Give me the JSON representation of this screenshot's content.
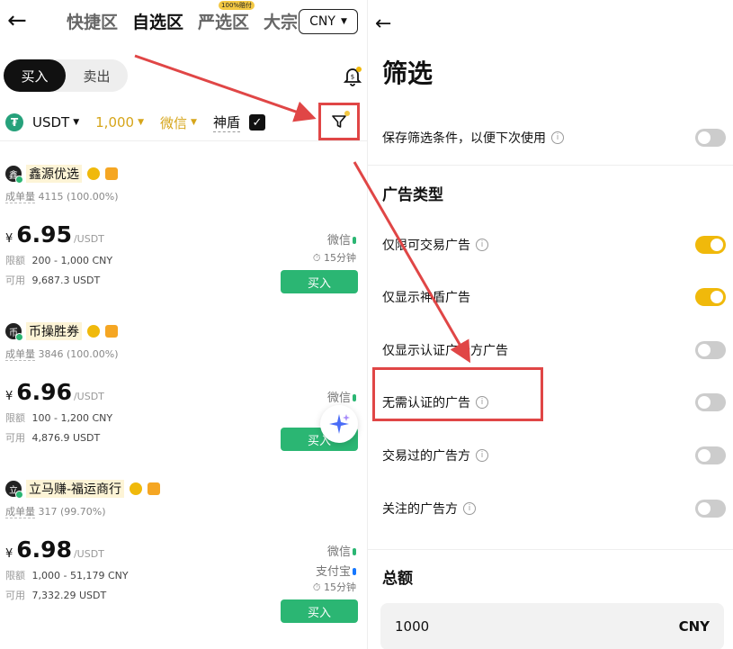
{
  "left": {
    "back_icon": "back-arrow-icon",
    "tabs": [
      {
        "label": "快捷区",
        "active": false
      },
      {
        "label": "自选区",
        "active": true
      },
      {
        "label": "严选区",
        "active": false,
        "badge": "100%赔付"
      },
      {
        "label": "大宗",
        "active": false
      }
    ],
    "currency": "CNY",
    "segment": {
      "buy": "买入",
      "sell": "卖出"
    },
    "filters": {
      "coin": "USDT",
      "amount": "1,000",
      "payment": "微信",
      "shield": "神盾"
    },
    "ads": [
      {
        "avatar": "鑫",
        "name": "鑫源优选",
        "orders_label": "成单量",
        "orders": "4115 (100.00%)",
        "currency_symbol": "¥",
        "price": "6.95",
        "unit": "/USDT",
        "limit_label": "限额",
        "limit": "200 - 1,000 CNY",
        "avail_label": "可用",
        "available": "9,687.3 USDT",
        "payments": [
          "微信"
        ],
        "time": "15分钟",
        "button": "买入"
      },
      {
        "avatar": "币",
        "name": "币操胜券",
        "orders_label": "成单量",
        "orders": "3846 (100.00%)",
        "currency_symbol": "¥",
        "price": "6.96",
        "unit": "/USDT",
        "limit_label": "限额",
        "limit": "100 - 1,200 CNY",
        "avail_label": "可用",
        "available": "4,876.9 USDT",
        "payments": [
          "微信"
        ],
        "button": "买入"
      },
      {
        "avatar": "立",
        "name": "立马赚-福运商行",
        "orders_label": "成单量",
        "orders": "317 (99.70%)",
        "currency_symbol": "¥",
        "price": "6.98",
        "unit": "/USDT",
        "limit_label": "限额",
        "limit": "1,000 - 51,179 CNY",
        "avail_label": "可用",
        "available": "7,332.29 USDT",
        "payments": [
          "微信",
          "支付宝"
        ],
        "time": "15分钟",
        "button": "买入"
      }
    ]
  },
  "right": {
    "title": "筛选",
    "save_filter": {
      "label": "保存筛选条件，以便下次使用",
      "on": false
    },
    "ad_type_heading": "广告类型",
    "options": [
      {
        "label": "仅限可交易广告",
        "on": true
      },
      {
        "label": "仅显示神盾广告",
        "on": true
      },
      {
        "label": "仅显示认证广告方广告",
        "on": false
      },
      {
        "label": "无需认证的广告",
        "on": false
      },
      {
        "label": "交易过的广告方",
        "on": false
      },
      {
        "label": "关注的广告方",
        "on": false
      }
    ],
    "total_heading": "总额",
    "amount_value": "1000",
    "amount_currency": "CNY"
  },
  "colors": {
    "accent": "#f0b90b",
    "buy_green": "#2bb673",
    "annotation_red": "#e04646"
  }
}
